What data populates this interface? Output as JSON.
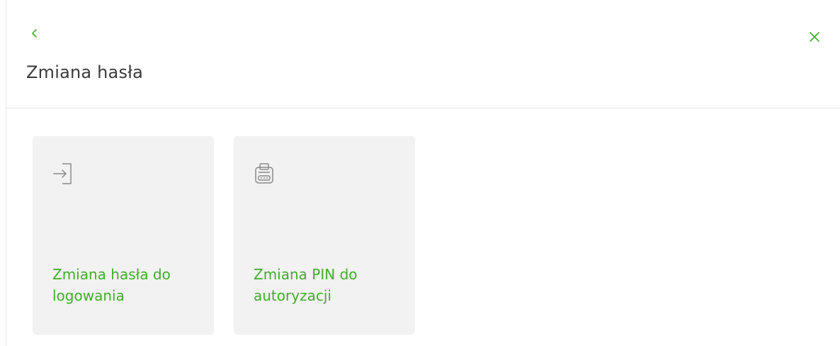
{
  "header": {
    "title": "Zmiana hasła",
    "back_icon": "chevron-left-icon",
    "close_icon": "close-icon"
  },
  "tiles": [
    {
      "label": "Zmiana hasła do\nlogowania",
      "icon": "login-icon"
    },
    {
      "label": "Zmiana PIN do\nautoryzacji",
      "icon": "pin-device-icon"
    }
  ],
  "colors": {
    "accent": "#3fae29",
    "tile_bg": "#f2f2f2",
    "icon": "#8a8a8a",
    "title": "#3a3a3a"
  }
}
